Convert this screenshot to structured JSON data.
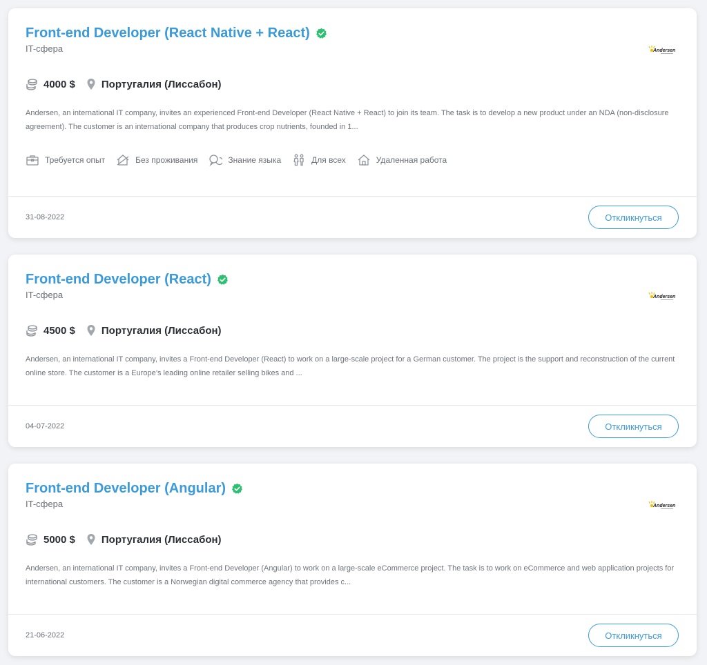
{
  "colors": {
    "accent": "#3b9ad9",
    "verified": "#2fbf71",
    "text_dark": "#2c2f36",
    "text_muted": "#6b6f77"
  },
  "vacancies": [
    {
      "title": "Front-end Developer (React Native + React)",
      "category": "IT-сфера",
      "salary": "4000 $",
      "location": "Португалия (Лиссабон)",
      "description": "Andersen, an international IT company, invites an experienced Front-end Developer (React Native + React) to join its team. The task is to develop a new product under an NDA (non-disclosure agreement). The customer is an international company that produces crop nutrients, founded in 1...",
      "features": [
        {
          "icon": "briefcase-icon",
          "label": "Требуется опыт"
        },
        {
          "icon": "house-crossed-icon",
          "label": "Без проживания"
        },
        {
          "icon": "chat-bubbles-icon",
          "label": "Знание языка"
        },
        {
          "icon": "people-icon",
          "label": "Для всех"
        },
        {
          "icon": "home-icon",
          "label": "Удаленная работа"
        }
      ],
      "date": "31-08-2022",
      "apply_label": "Откликнуться"
    },
    {
      "title": "Front-end Developer (React)",
      "category": "IT-сфера",
      "salary": "4500 $",
      "location": "Португалия (Лиссабон)",
      "description": "Andersen, an international IT company, invites a Front-end Developer (React) to work on a large-scale project for a German customer. The project is the support and reconstruction of the current online store. The customer is a Europe’s leading online retailer selling bikes and ...",
      "date": "04-07-2022",
      "apply_label": "Откликнуться"
    },
    {
      "title": "Front-end Developer (Angular)",
      "category": "IT-сфера",
      "salary": "5000 $",
      "location": "Португалия (Лиссабон)",
      "description": "Andersen, an international IT company, invites a Front-end Developer (Angular) to work on a large-scale eCommerce project. The task is to work on eCommerce and web application projects for international customers. The customer is a Norwegian digital commerce agency that provides c...",
      "date": "21-06-2022",
      "apply_label": "Откликнуться"
    }
  ],
  "logo": {
    "icon": "andersen-logo",
    "text": "Andersen"
  }
}
